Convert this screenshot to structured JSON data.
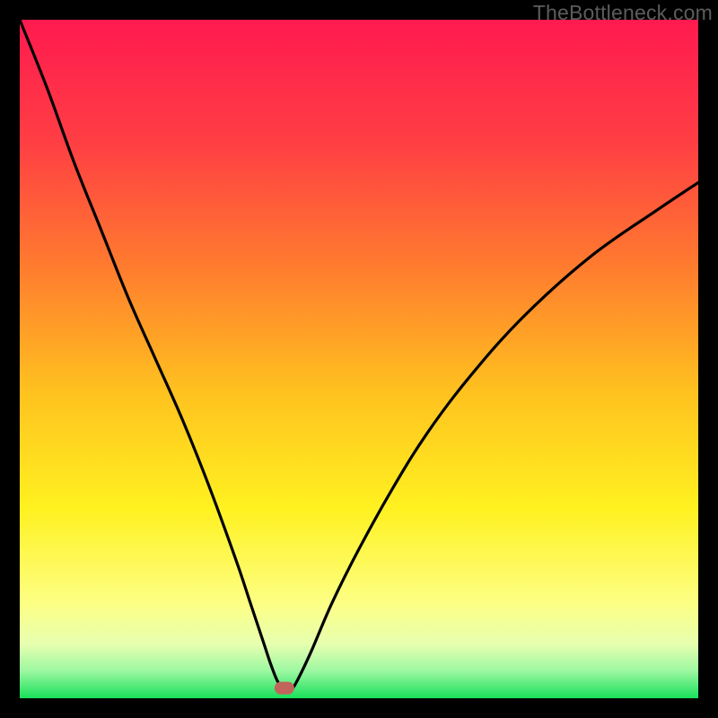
{
  "watermark": "TheBottleneck.com",
  "chart_data": {
    "type": "line",
    "title": "",
    "xlabel": "",
    "ylabel": "",
    "xlim": [
      0,
      100
    ],
    "ylim": [
      0,
      100
    ],
    "background": "rainbow-vertical",
    "grid": false,
    "legend": false,
    "annotations": [
      {
        "name": "minimum-marker",
        "shape": "pill",
        "x": 39,
        "y": 1.5,
        "color": "#c1645b"
      }
    ],
    "series": [
      {
        "name": "bottleneck-curve",
        "color": "#000000",
        "x": [
          0,
          4,
          8,
          12,
          16,
          20,
          24,
          28,
          32,
          34,
          36,
          37,
          38,
          39,
          40,
          41,
          43,
          46,
          50,
          55,
          60,
          66,
          74,
          84,
          94,
          100
        ],
        "values": [
          100,
          90,
          79,
          69,
          59,
          50,
          41,
          31,
          20,
          14,
          8,
          5,
          2.5,
          1.3,
          1.3,
          2.8,
          7,
          14,
          22,
          31,
          39,
          47,
          56,
          65,
          72,
          76
        ]
      }
    ],
    "gradient_stops": [
      {
        "offset": 0.0,
        "color": "#ff1a4f"
      },
      {
        "offset": 0.18,
        "color": "#ff3e44"
      },
      {
        "offset": 0.36,
        "color": "#ff7a2f"
      },
      {
        "offset": 0.55,
        "color": "#ffc21f"
      },
      {
        "offset": 0.72,
        "color": "#fff120"
      },
      {
        "offset": 0.86,
        "color": "#fdff84"
      },
      {
        "offset": 0.92,
        "color": "#e7ffb0"
      },
      {
        "offset": 0.96,
        "color": "#9cf7a1"
      },
      {
        "offset": 1.0,
        "color": "#18e05a"
      }
    ]
  }
}
